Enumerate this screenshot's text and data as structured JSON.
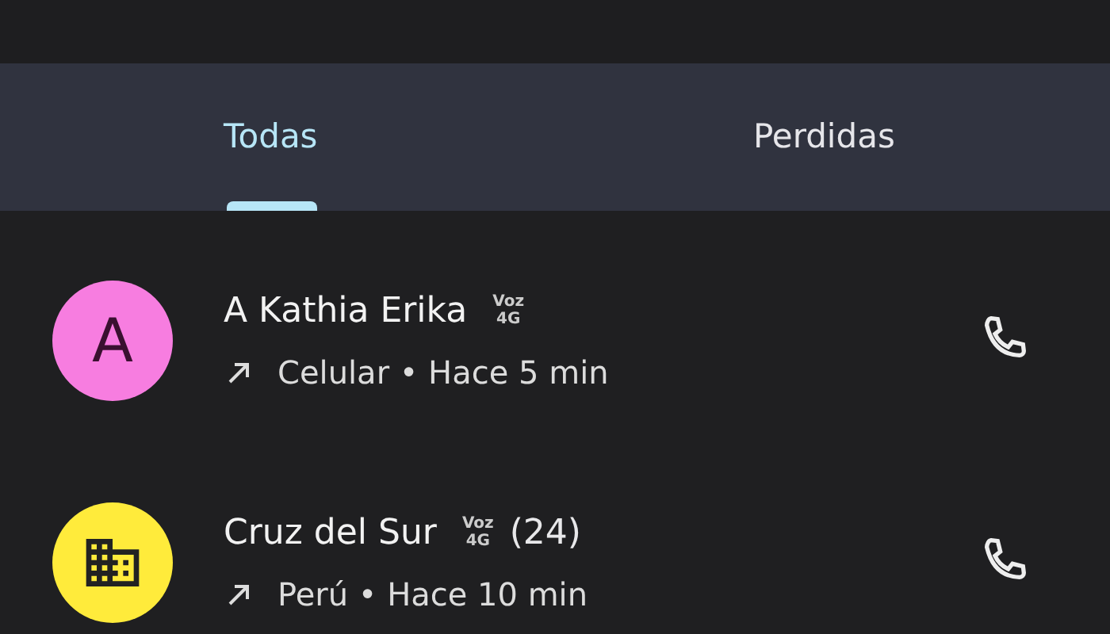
{
  "tabs": [
    {
      "label": "Todas",
      "selected": true
    },
    {
      "label": "Perdidas",
      "selected": false
    }
  ],
  "calls": [
    {
      "avatar": {
        "kind": "letter",
        "letter": "A",
        "color": "#f77de0"
      },
      "name": "A Kathia Erika",
      "badge": [
        "Voz",
        "4G"
      ],
      "detail": "Celular • Hace 5 min"
    },
    {
      "avatar": {
        "kind": "building",
        "color": "#ffeb3b"
      },
      "name": "Cruz del Sur",
      "badge": [
        "Voz",
        "4G"
      ],
      "count": "(24)",
      "detail": "Perú • Hace 10 min"
    }
  ]
}
